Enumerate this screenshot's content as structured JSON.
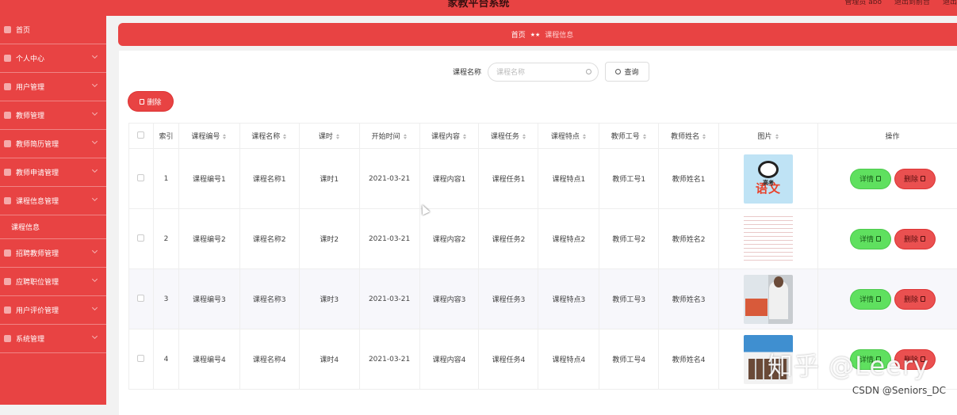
{
  "header": {
    "title": "家教平台系统",
    "links": [
      "管理员 abo",
      "退出到前台",
      "退出"
    ]
  },
  "sidebar": {
    "items": [
      {
        "label": "首页",
        "icon": "home-icon"
      },
      {
        "label": "个人中心",
        "icon": "person-icon"
      },
      {
        "label": "用户管理",
        "icon": "grid-icon"
      },
      {
        "label": "教师管理",
        "icon": "clock-icon"
      },
      {
        "label": "教师简历管理",
        "icon": "shield-icon"
      },
      {
        "label": "教师申请管理",
        "icon": "bulb-icon"
      },
      {
        "label": "课程信息管理",
        "icon": "list-icon"
      },
      {
        "label": "课程信息",
        "sub": true
      },
      {
        "label": "招聘教师管理",
        "icon": "chat-icon"
      },
      {
        "label": "应聘职位管理",
        "icon": "gear-icon"
      },
      {
        "label": "用户评价管理",
        "icon": "grid-icon"
      },
      {
        "label": "系统管理",
        "icon": "grid-icon"
      }
    ]
  },
  "breadcrumb": {
    "home": "首页",
    "separator": "★★",
    "current": "课程信息"
  },
  "search": {
    "label": "课程名称",
    "placeholder": "课程名称",
    "button": "查询"
  },
  "toolbar": {
    "delete_label": "删除"
  },
  "table": {
    "headers": [
      "索引",
      "课程编号",
      "课程名称",
      "课时",
      "开始时间",
      "课程内容",
      "课程任务",
      "课程特点",
      "教师工号",
      "教师姓名",
      "图片",
      "操作"
    ],
    "rows": [
      {
        "index": "1",
        "code": "课程编号1",
        "name": "课程名称1",
        "hours": "课时1",
        "start": "2021-03-21",
        "content": "课程内容1",
        "task": "课程任务1",
        "feature": "课程特点1",
        "tid": "教师工号1",
        "tname": "教师姓名1"
      },
      {
        "index": "2",
        "code": "课程编号2",
        "name": "课程名称2",
        "hours": "课时2",
        "start": "2021-03-21",
        "content": "课程内容2",
        "task": "课程任务2",
        "feature": "课程特点2",
        "tid": "教师工号2",
        "tname": "教师姓名2"
      },
      {
        "index": "3",
        "code": "课程编号3",
        "name": "课程名称3",
        "hours": "课时3",
        "start": "2021-03-21",
        "content": "课程内容3",
        "task": "课程任务3",
        "feature": "课程特点3",
        "tid": "教师工号3",
        "tname": "教师姓名3"
      },
      {
        "index": "4",
        "code": "课程编号4",
        "name": "课程名称4",
        "hours": "课时4",
        "start": "2021-03-21",
        "content": "课程内容4",
        "task": "课程任务4",
        "feature": "课程特点4",
        "tid": "教师工号4",
        "tname": "教师姓名4"
      }
    ],
    "actions": {
      "detail": "详情",
      "delete": "删除"
    }
  },
  "image1": {
    "top": "高考",
    "big": "语文"
  },
  "watermark": {
    "main": "知乎 @Leery",
    "sub": "CSDN @Seniors_DC"
  },
  "colors": {
    "primary": "#e84343",
    "detail": "#5fe05f"
  }
}
